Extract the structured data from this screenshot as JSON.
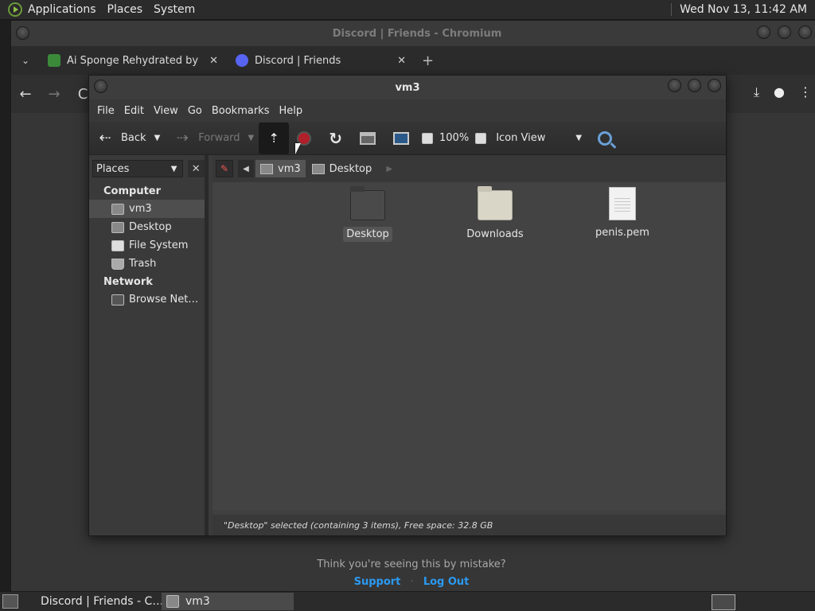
{
  "top_panel": {
    "menus": [
      "Applications",
      "Places",
      "System"
    ],
    "clock": "Wed Nov 13, 11:42 AM"
  },
  "chromium": {
    "title": "Discord | Friends - Chromium",
    "tabs": [
      {
        "label": "Ai Sponge Rehydrated by Po",
        "favicon_color": "#3a8a3a"
      },
      {
        "label": "Discord | Friends",
        "favicon_color": "#5865f2"
      }
    ],
    "omnibox_partial": "C",
    "page": {
      "mistake_text": "Think you're seeing this by mistake?",
      "support_link": "Support",
      "separator": "·",
      "logout_link": "Log Out"
    }
  },
  "nautilus": {
    "title": "vm3",
    "menu": [
      "File",
      "Edit",
      "View",
      "Go",
      "Bookmarks",
      "Help"
    ],
    "toolbar": {
      "back": "Back",
      "forward": "Forward",
      "zoom": "100%",
      "view_mode": "Icon View"
    },
    "sidebar": {
      "combo_label": "Places",
      "sections": [
        {
          "header": "Computer",
          "items": [
            "vm3",
            "Desktop",
            "File System",
            "Trash"
          ]
        },
        {
          "header": "Network",
          "items": [
            "Browse Net…"
          ]
        }
      ]
    },
    "pathbar": [
      "vm3",
      "Desktop"
    ],
    "files": [
      {
        "name": "Desktop",
        "type": "folder-dark",
        "selected": true
      },
      {
        "name": "Downloads",
        "type": "folder",
        "selected": false
      },
      {
        "name": "penis.pem",
        "type": "document",
        "selected": false
      }
    ],
    "status": "\"Desktop\" selected (containing 3 items), Free space: 32.8 GB"
  },
  "taskbar": {
    "tasks": [
      {
        "label": "Discord | Friends - C…",
        "icon": "chromium-icon"
      },
      {
        "label": "vm3",
        "icon": "folder-icon"
      }
    ]
  }
}
